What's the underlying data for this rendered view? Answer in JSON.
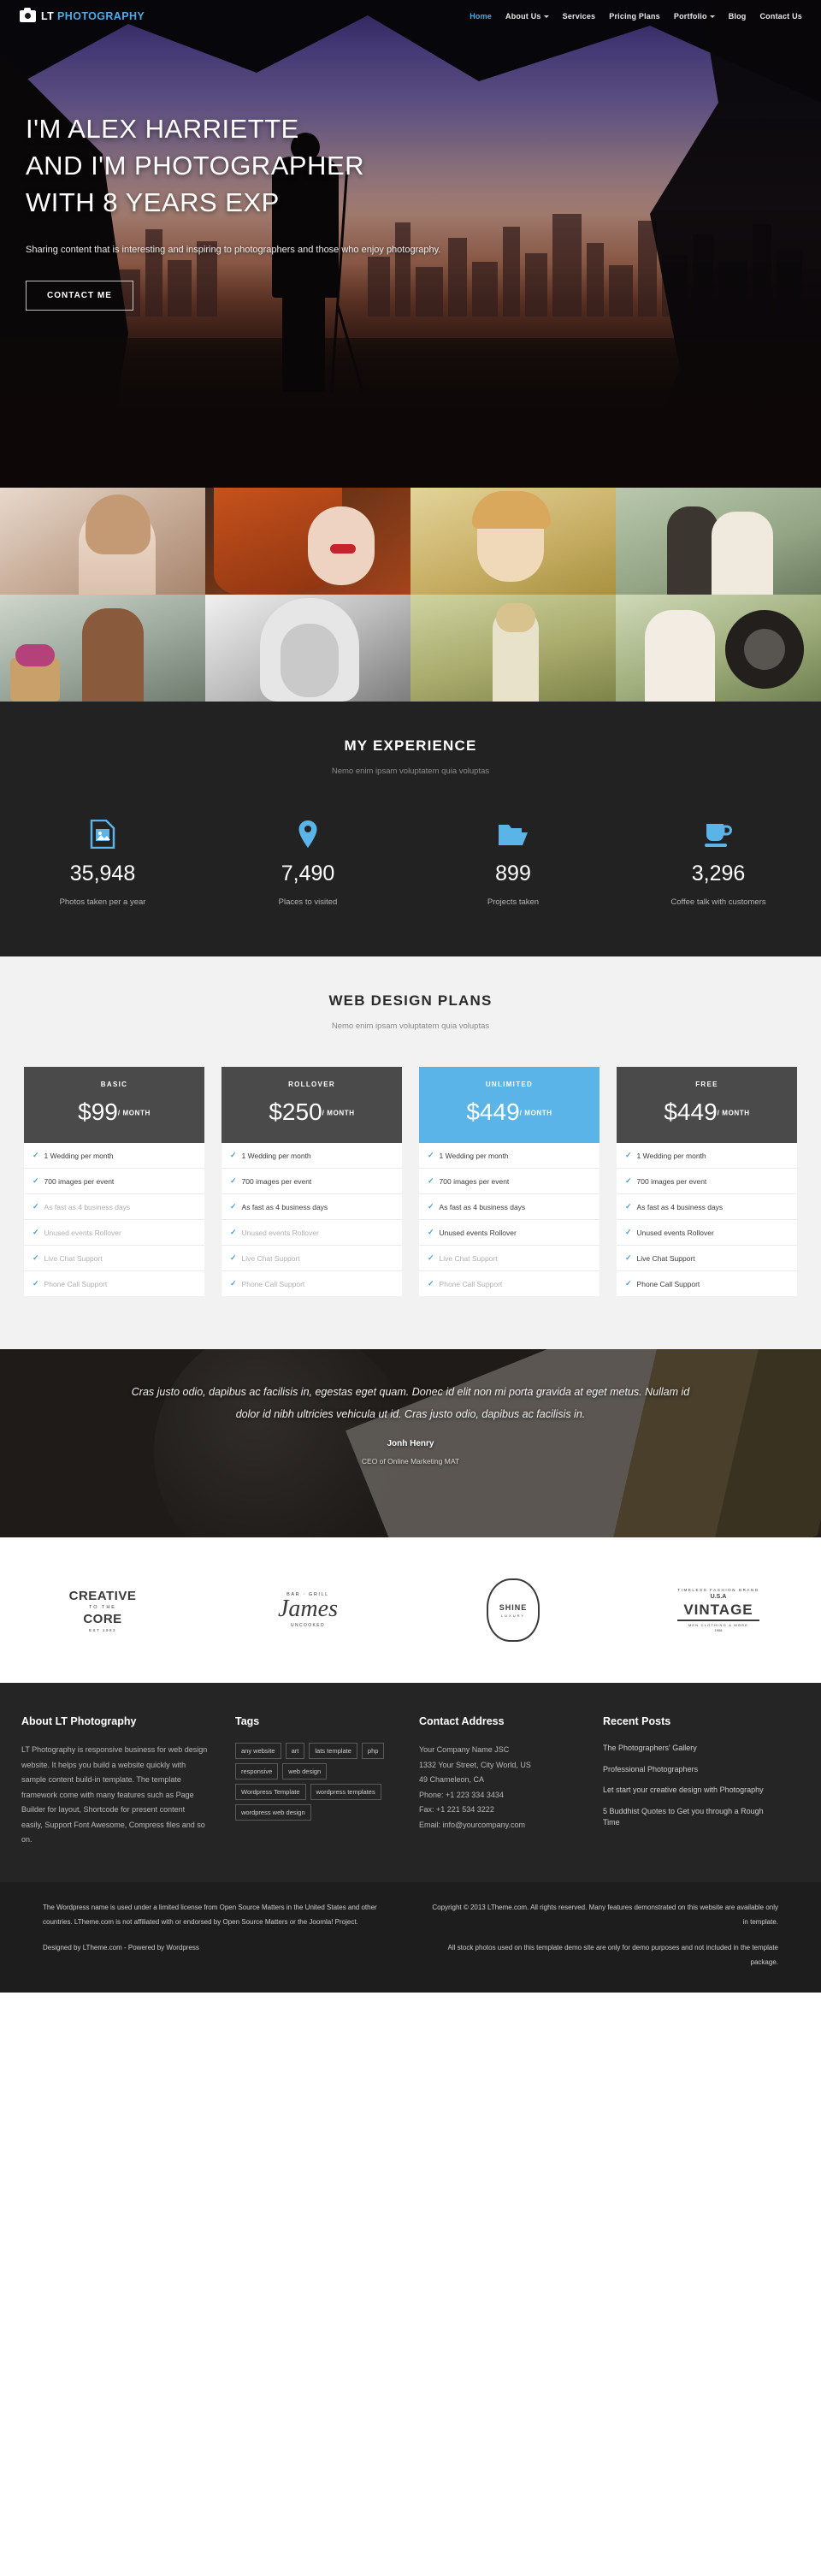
{
  "brand": {
    "lt": "LT",
    "photography": "PHOTOGRAPHY",
    "accent": "#4aa8e4"
  },
  "nav": [
    {
      "label": "Home",
      "active": true,
      "caret": false
    },
    {
      "label": "About Us",
      "active": false,
      "caret": true
    },
    {
      "label": "Services",
      "active": false,
      "caret": false
    },
    {
      "label": "Pricing Plans",
      "active": false,
      "caret": false
    },
    {
      "label": "Portfolio",
      "active": false,
      "caret": true
    },
    {
      "label": "Blog",
      "active": false,
      "caret": false
    },
    {
      "label": "Contact Us",
      "active": false,
      "caret": false
    }
  ],
  "hero": {
    "line1": "I'M ALEX HARRIETTE",
    "line2": "AND I'M PHOTOGRAPHER",
    "line3": "WITH 8 YEARS EXP",
    "subtitle": "Sharing content that is interesting and inspiring to photographers and those who enjoy photography.",
    "cta": "CONTACT ME"
  },
  "experience": {
    "title": "MY EXPERIENCE",
    "subtitle": "Nemo enim ipsam voluptatem quia voluptas",
    "accent": "#5bb4e8",
    "stats": [
      {
        "icon": "image-file-icon",
        "number": "35,948",
        "label": "Photos taken per a year"
      },
      {
        "icon": "map-pin-icon",
        "number": "7,490",
        "label": "Places to visited"
      },
      {
        "icon": "folder-open-icon",
        "number": "899",
        "label": "Projects taken"
      },
      {
        "icon": "coffee-cup-icon",
        "number": "3,296",
        "label": "Coffee talk with customers"
      }
    ]
  },
  "pricing": {
    "title": "WEB DESIGN PLANS",
    "subtitle": "Nemo enim ipsam voluptatem quia voluptas",
    "featured_color": "#5bb4e8",
    "plans": [
      {
        "name": "BASIC",
        "price": "$99",
        "per": "/ MONTH",
        "featured": false,
        "features": [
          {
            "text": "1 Wedding per month",
            "dim": false
          },
          {
            "text": "700 images per event",
            "dim": false
          },
          {
            "text": "As fast as 4 business days",
            "dim": true
          },
          {
            "text": "Unused events Rollover",
            "dim": true
          },
          {
            "text": "Live Chat Support",
            "dim": true
          },
          {
            "text": "Phone Call Support",
            "dim": true
          }
        ]
      },
      {
        "name": "ROLLOVER",
        "price": "$250",
        "per": "/ MONTH",
        "featured": false,
        "features": [
          {
            "text": "1 Wedding per month",
            "dim": false
          },
          {
            "text": "700 images per event",
            "dim": false
          },
          {
            "text": "As fast as 4 business days",
            "dim": false
          },
          {
            "text": "Unused events Rollover",
            "dim": true
          },
          {
            "text": "Live Chat Support",
            "dim": true
          },
          {
            "text": "Phone Call Support",
            "dim": true
          }
        ]
      },
      {
        "name": "UNLIMITED",
        "price": "$449",
        "per": "/ MONTH",
        "featured": true,
        "features": [
          {
            "text": "1 Wedding per month",
            "dim": false
          },
          {
            "text": "700 images per event",
            "dim": false
          },
          {
            "text": "As fast as 4 business days",
            "dim": false
          },
          {
            "text": "Unused events Rollover",
            "dim": false
          },
          {
            "text": "Live Chat Support",
            "dim": true
          },
          {
            "text": "Phone Call Support",
            "dim": true
          }
        ]
      },
      {
        "name": "FREE",
        "price": "$449",
        "per": "/ MONTH",
        "featured": false,
        "features": [
          {
            "text": "1 Wedding per month",
            "dim": false
          },
          {
            "text": "700 images per event",
            "dim": false
          },
          {
            "text": "As fast as 4 business days",
            "dim": false
          },
          {
            "text": "Unused events Rollover",
            "dim": false
          },
          {
            "text": "Live Chat Support",
            "dim": false
          },
          {
            "text": "Phone Call Support",
            "dim": false
          }
        ]
      }
    ]
  },
  "testimonial": {
    "quote": "Cras justo odio, dapibus ac facilisis in, egestas eget quam. Donec id elit non mi porta gravida at eget metus. Nullam id dolor id nibh ultricies vehicula ut id. Cras justo odio, dapibus ac facilisis in.",
    "name": "Jonh Henry",
    "role": "CEO of Online Marketing MAT"
  },
  "clients": [
    {
      "name": "creative-to-the-core-logo",
      "line1": "CREATIVE",
      "line2": "TO THE",
      "line3": "CORE",
      "line4": "EST 1983"
    },
    {
      "name": "james-bar-grill-logo",
      "line1": "BAR · GRILL",
      "line2": "James",
      "line3": "UNCOOKED"
    },
    {
      "name": "shine-luxury-logo",
      "line1": "SHINE",
      "line2": "LUXURY"
    },
    {
      "name": "vintage-usa-logo",
      "line1": "TIMELESS FASHION BRAND",
      "line2": "U.S.A",
      "line3": "VINTAGE",
      "line4": "MEN CLOTHING & MORE",
      "line5": "1958"
    }
  ],
  "footer": {
    "about": {
      "heading": "About LT Photography",
      "body": "LT Photography is responsive business for web design website. It helps you build a website quickly with sample content build-in template. The template framework come with many features such as Page Builder for layout, Shortcode for present content easily, Support Font Awesome, Compress files and so on."
    },
    "tags": {
      "heading": "Tags",
      "items": [
        "any website",
        "art",
        "lats template",
        "php",
        "responsive",
        "web design",
        "Wordpress Template",
        "wordpress templates",
        "wordpress web design"
      ]
    },
    "contact": {
      "heading": "Contact Address",
      "lines": [
        "Your Company Name JSC",
        "1332 Your Street, City World, US",
        "49 Chameleon, CA",
        "Phone: +1 223 334 3434",
        "Fax: +1 221 534 3222",
        "Email: info@yourcompany.com"
      ]
    },
    "posts": {
      "heading": "Recent Posts",
      "items": [
        "The Photographers' Gallery",
        "Professional Photographers",
        "Let start your creative design with Photography",
        "5 Buddhist Quotes to Get you through a Rough Time"
      ]
    }
  },
  "bottom": {
    "left_1": "The Wordpress name is used under a limited license from Open Source Matters in the United States and other countries. LTheme.com is not affiliated with or endorsed by Open Source Matters or the Joomla! Project.",
    "left_2": "Designed by LTheme.com - Powered by Wordpress",
    "right_1": "Copyright © 2013 LTheme.com. All rights reserved. Many features demonstrated on this website are available only in template.",
    "right_2": "All stock photos used on this template demo site are only for demo purposes and not included in the template package."
  }
}
